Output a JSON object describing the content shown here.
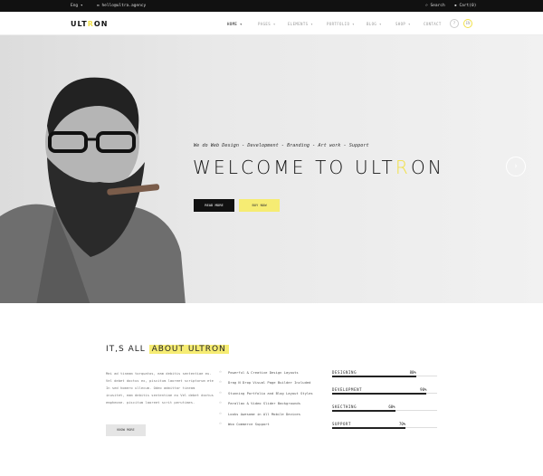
{
  "topbar": {
    "language": "Eng",
    "email": "hello@ultra.agency",
    "search": "Search",
    "cart": "Cart(0)"
  },
  "header": {
    "logo_start": "ULT",
    "logo_mid": "R",
    "logo_end": "ON",
    "nav": [
      "HOME",
      "PAGES",
      "ELEMENTS",
      "PORTFOLIO",
      "BLOG",
      "SHOP",
      "CONTACT"
    ],
    "icon_circle_1": "?",
    "icon_circle_2": "EN"
  },
  "hero": {
    "subtitle": "We do Web Design - Development - Branding - Art work - Support",
    "title_start": "WELCOME TO ULT",
    "title_mid": "R",
    "title_end": "ON",
    "read_more": "READ MORE",
    "buy_now": "BUY NOW",
    "next_arrow": "›"
  },
  "about": {
    "title_plain": "IT,S ALL ",
    "title_highlight": "ABOUT ULTRON",
    "paragraph": "Mei ad tineam torquatos, eam debitis sententiae eu. Vel debet doctus ex, piscitum laoreet scriptorum ete In sed homero ullecum. Odeo admittor tineam inusitet, eam debitis sententiae eu Vel debet doctus empheone. piscitum laoreet scrit perutimes.",
    "know_more": "KNOW MORE",
    "features": [
      "Powerful & Creative Design Layouts",
      "Drag N Drop Visual Page Builder Included",
      "Stunning Portfolio and Blog Layout Styles",
      "Parallax & Video Slider Backgrounds",
      "Looks Awesome in All Mobile Devices",
      "Woo Commerce Support"
    ],
    "skills": [
      {
        "name": "DESIGNING",
        "percent": 80,
        "label": "80%"
      },
      {
        "name": "DEVELOPMENT",
        "percent": 90,
        "label": "90%"
      },
      {
        "name": "SKECTHING",
        "percent": 60,
        "label": "60%"
      },
      {
        "name": "SUPPORT",
        "percent": 70,
        "label": "70%"
      }
    ]
  },
  "colors": {
    "accent": "#f1e14a",
    "dark": "#111111"
  }
}
